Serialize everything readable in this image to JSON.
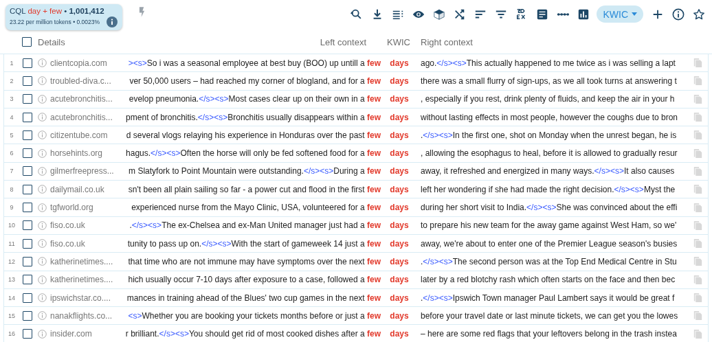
{
  "summary": {
    "prefix": "CQL",
    "query": "day + few",
    "separator": "•",
    "count": "1,001,412",
    "stats": "23.22 per million tokens • 0.0023%"
  },
  "view_menu": {
    "label": "KWIC"
  },
  "header": {
    "checked": false,
    "details": "Details",
    "left": "Left context",
    "kwic": "KWIC",
    "right": "Right context"
  },
  "rows": [
    {
      "n": "1",
      "checked": false,
      "source": "clientcopia.com",
      "left": [
        {
          "kind": "tag",
          "t": "><s>"
        },
        {
          "kind": "text",
          "t": "So i was a seasonal employee at best buy (BOO) up untill a "
        },
        {
          "kind": "hit",
          "t": "few"
        }
      ],
      "kwic": "days",
      "right": [
        {
          "kind": "text",
          "t": "ago."
        },
        {
          "kind": "tag",
          "t": "</s><s>"
        },
        {
          "kind": "text",
          "t": "This actually happened to me twice as i was selling a lapt"
        }
      ]
    },
    {
      "n": "2",
      "checked": false,
      "source": "troubled-diva.c...",
      "left": [
        {
          "kind": "text",
          "t": "ver 50,000 users – had reached my corner of blogland, and for a "
        },
        {
          "kind": "hit",
          "t": "few"
        }
      ],
      "kwic": "days",
      "right": [
        {
          "kind": "text",
          "t": "there was a small flurry of sign-ups, as we all took turns at answering t"
        }
      ]
    },
    {
      "n": "3",
      "checked": false,
      "source": "acutebronchitis...",
      "left": [
        {
          "kind": "text",
          "t": "evelop pneumonia."
        },
        {
          "kind": "tag",
          "t": "</s><s>"
        },
        {
          "kind": "text",
          "t": "Most cases clear up on their own in a "
        },
        {
          "kind": "hit",
          "t": "few"
        }
      ],
      "kwic": "days",
      "right": [
        {
          "kind": "text",
          "t": ", especially if you rest, drink plenty of fluids, and keep the air in your h"
        }
      ]
    },
    {
      "n": "4",
      "checked": false,
      "source": "acutebronchitis...",
      "left": [
        {
          "kind": "text",
          "t": "pment of bronchitis."
        },
        {
          "kind": "tag",
          "t": "</s><s>"
        },
        {
          "kind": "text",
          "t": "Bronchitis usually disappears within a "
        },
        {
          "kind": "hit",
          "t": "few"
        }
      ],
      "kwic": "days",
      "right": [
        {
          "kind": "text",
          "t": "without lasting effects in most people, however the coughs due to bron"
        }
      ]
    },
    {
      "n": "5",
      "checked": false,
      "source": "citizentube.com",
      "left": [
        {
          "kind": "text",
          "t": "d several vlogs relaying his experience in Honduras over the past "
        },
        {
          "kind": "hit",
          "t": "few"
        }
      ],
      "kwic": "days",
      "right": [
        {
          "kind": "text",
          "t": "."
        },
        {
          "kind": "tag",
          "t": "</s><s>"
        },
        {
          "kind": "text",
          "t": "In the first one, shot on Monday when the unrest began, he is"
        }
      ]
    },
    {
      "n": "6",
      "checked": false,
      "source": "horsehints.org",
      "left": [
        {
          "kind": "text",
          "t": "hagus."
        },
        {
          "kind": "tag",
          "t": "</s><s>"
        },
        {
          "kind": "text",
          "t": "Often the horse will only be fed softened food for a "
        },
        {
          "kind": "hit",
          "t": "few"
        }
      ],
      "kwic": "days",
      "right": [
        {
          "kind": "text",
          "t": ", allowing the esophagus to heal, before it is allowed to gradually resur"
        }
      ]
    },
    {
      "n": "7",
      "checked": false,
      "source": "gilmerfreepress...",
      "left": [
        {
          "kind": "text",
          "t": "m Slatyfork to Point Mountain were outstanding."
        },
        {
          "kind": "tag",
          "t": "</s><s>"
        },
        {
          "kind": "text",
          "t": "During a "
        },
        {
          "kind": "hit",
          "t": "few"
        }
      ],
      "kwic": "days",
      "right": [
        {
          "kind": "text",
          "t": "away, it refreshed and energized in many ways."
        },
        {
          "kind": "tag",
          "t": "</s><s>"
        },
        {
          "kind": "text",
          "t": "It also causes"
        }
      ]
    },
    {
      "n": "8",
      "checked": false,
      "source": "dailymail.co.uk",
      "left": [
        {
          "kind": "text",
          "t": "sn't been all plain sailing so far - a power cut and flood in the first "
        },
        {
          "kind": "hit",
          "t": "few"
        }
      ],
      "kwic": "days",
      "right": [
        {
          "kind": "text",
          "t": "left her wondering if she had made the right decision."
        },
        {
          "kind": "tag",
          "t": "</s><s>"
        },
        {
          "kind": "text",
          "t": "Myst the"
        }
      ]
    },
    {
      "n": "9",
      "checked": false,
      "source": "tgfworld.org",
      "left": [
        {
          "kind": "text",
          "t": "experienced nurse from the Mayo Clinic, USA, volunteered for a "
        },
        {
          "kind": "hit",
          "t": "few"
        }
      ],
      "kwic": "days",
      "right": [
        {
          "kind": "text",
          "t": "during her short visit to India."
        },
        {
          "kind": "tag",
          "t": "</s><s>"
        },
        {
          "kind": "text",
          "t": "She was convinced about the effi"
        }
      ]
    },
    {
      "n": "10",
      "checked": false,
      "source": "fiso.co.uk",
      "left": [
        {
          "kind": "text",
          "t": "."
        },
        {
          "kind": "tag",
          "t": "</s><s>"
        },
        {
          "kind": "text",
          "t": "The ex-Chelsea and ex-Man United manager just had a "
        },
        {
          "kind": "hit",
          "t": "few"
        }
      ],
      "kwic": "days",
      "right": [
        {
          "kind": "text",
          "t": "to prepare his new team for the away game against West Ham, so we'"
        }
      ]
    },
    {
      "n": "11",
      "checked": false,
      "source": "fiso.co.uk",
      "left": [
        {
          "kind": "text",
          "t": "tunity to pass up on."
        },
        {
          "kind": "tag",
          "t": "</s><s>"
        },
        {
          "kind": "text",
          "t": "With the start of gameweek 14 just a "
        },
        {
          "kind": "hit",
          "t": "few"
        }
      ],
      "kwic": "days",
      "right": [
        {
          "kind": "text",
          "t": "away, we're about to enter one of the Premier League season's busies"
        }
      ]
    },
    {
      "n": "12",
      "checked": false,
      "source": "katherinetimes....",
      "left": [
        {
          "kind": "text",
          "t": "that time who are not immune may have symptoms over the next "
        },
        {
          "kind": "hit",
          "t": "few"
        }
      ],
      "kwic": "days",
      "right": [
        {
          "kind": "text",
          "t": "."
        },
        {
          "kind": "tag",
          "t": "</s><s>"
        },
        {
          "kind": "text",
          "t": "The second person was at the Top End Medical Centre in Stu"
        }
      ]
    },
    {
      "n": "13",
      "checked": false,
      "source": "katherinetimes....",
      "left": [
        {
          "kind": "text",
          "t": "hich usually occur 7-10 days after exposure to a case, followed a "
        },
        {
          "kind": "hit",
          "t": "few"
        }
      ],
      "kwic": "days",
      "right": [
        {
          "kind": "text",
          "t": "later by a red blotchy rash which often starts on the face and then bec"
        }
      ]
    },
    {
      "n": "14",
      "checked": false,
      "source": "ipswichstar.co....",
      "left": [
        {
          "kind": "text",
          "t": "mances in training ahead of the Blues' two cup games in the next "
        },
        {
          "kind": "hit",
          "t": "few"
        }
      ],
      "kwic": "days",
      "right": [
        {
          "kind": "text",
          "t": "."
        },
        {
          "kind": "tag",
          "t": "</s><s>"
        },
        {
          "kind": "text",
          "t": "Ipswich Town manager Paul Lambert says it would be great f"
        }
      ]
    },
    {
      "n": "15",
      "checked": false,
      "source": "nanakflights.co...",
      "left": [
        {
          "kind": "tag",
          "t": "<s>"
        },
        {
          "kind": "text",
          "t": "Whether you are booking your tickets months before or just a "
        },
        {
          "kind": "hit",
          "t": "few"
        }
      ],
      "kwic": "days",
      "right": [
        {
          "kind": "text",
          "t": "before your travel date or last minute tickets, we can get you the lowes"
        }
      ]
    },
    {
      "n": "16",
      "checked": false,
      "source": "insider.com",
      "left": [
        {
          "kind": "text",
          "t": "r brilliant."
        },
        {
          "kind": "tag",
          "t": "</s><s>"
        },
        {
          "kind": "text",
          "t": "You should get rid of most cooked dishes after a "
        },
        {
          "kind": "hit",
          "t": "few"
        }
      ],
      "kwic": "days",
      "right": [
        {
          "kind": "text",
          "t": "– here are some red flags that your leftovers belong in the trash instea"
        }
      ]
    }
  ]
}
